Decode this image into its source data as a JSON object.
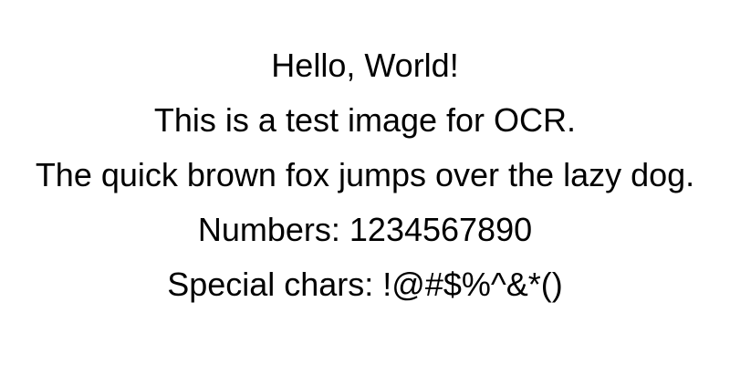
{
  "document": {
    "lines": [
      "Hello, World!",
      "This is a test image for OCR.",
      "The quick brown fox jumps over the lazy dog.",
      "Numbers: 1234567890",
      "Special chars: !@#$%^&*()"
    ]
  }
}
